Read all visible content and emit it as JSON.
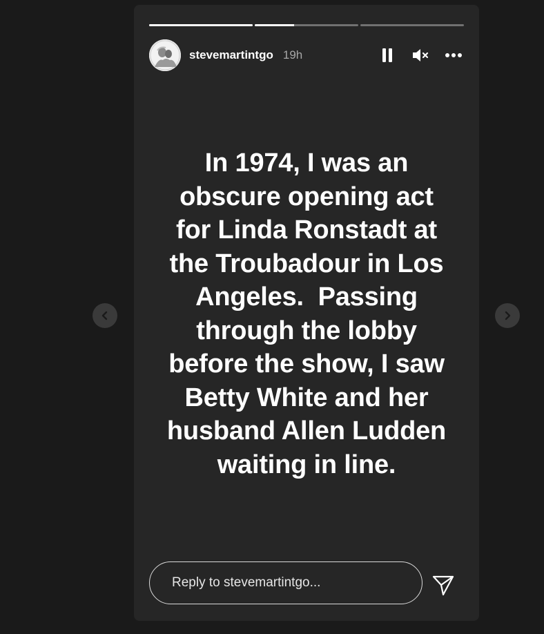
{
  "story": {
    "username": "stevemartintgo",
    "timestamp": "19h",
    "progress": [
      1.0,
      0.38,
      0.0
    ],
    "text_lines": [
      "In 1974, I was an",
      "obscure opening act",
      "for Linda Ronstadt at",
      "the Troubadour in Los",
      "Angeles.  Passing",
      "through the lobby",
      "before the show, I saw",
      "Betty White and her",
      "husband Allen Ludden",
      "waiting in line."
    ]
  },
  "controls": {
    "pause_icon": "pause-icon",
    "mute_icon": "speaker-muted-icon",
    "more_icon": "more-horizontal-icon"
  },
  "reply": {
    "placeholder": "Reply to stevemartintgo..."
  },
  "navigation": {
    "prev_icon": "chevron-left-icon",
    "next_icon": "chevron-right-icon"
  },
  "colors": {
    "background": "#1a1a1a",
    "card": "#262626",
    "text": "#ffffff",
    "muted": "#a8a8a8"
  }
}
